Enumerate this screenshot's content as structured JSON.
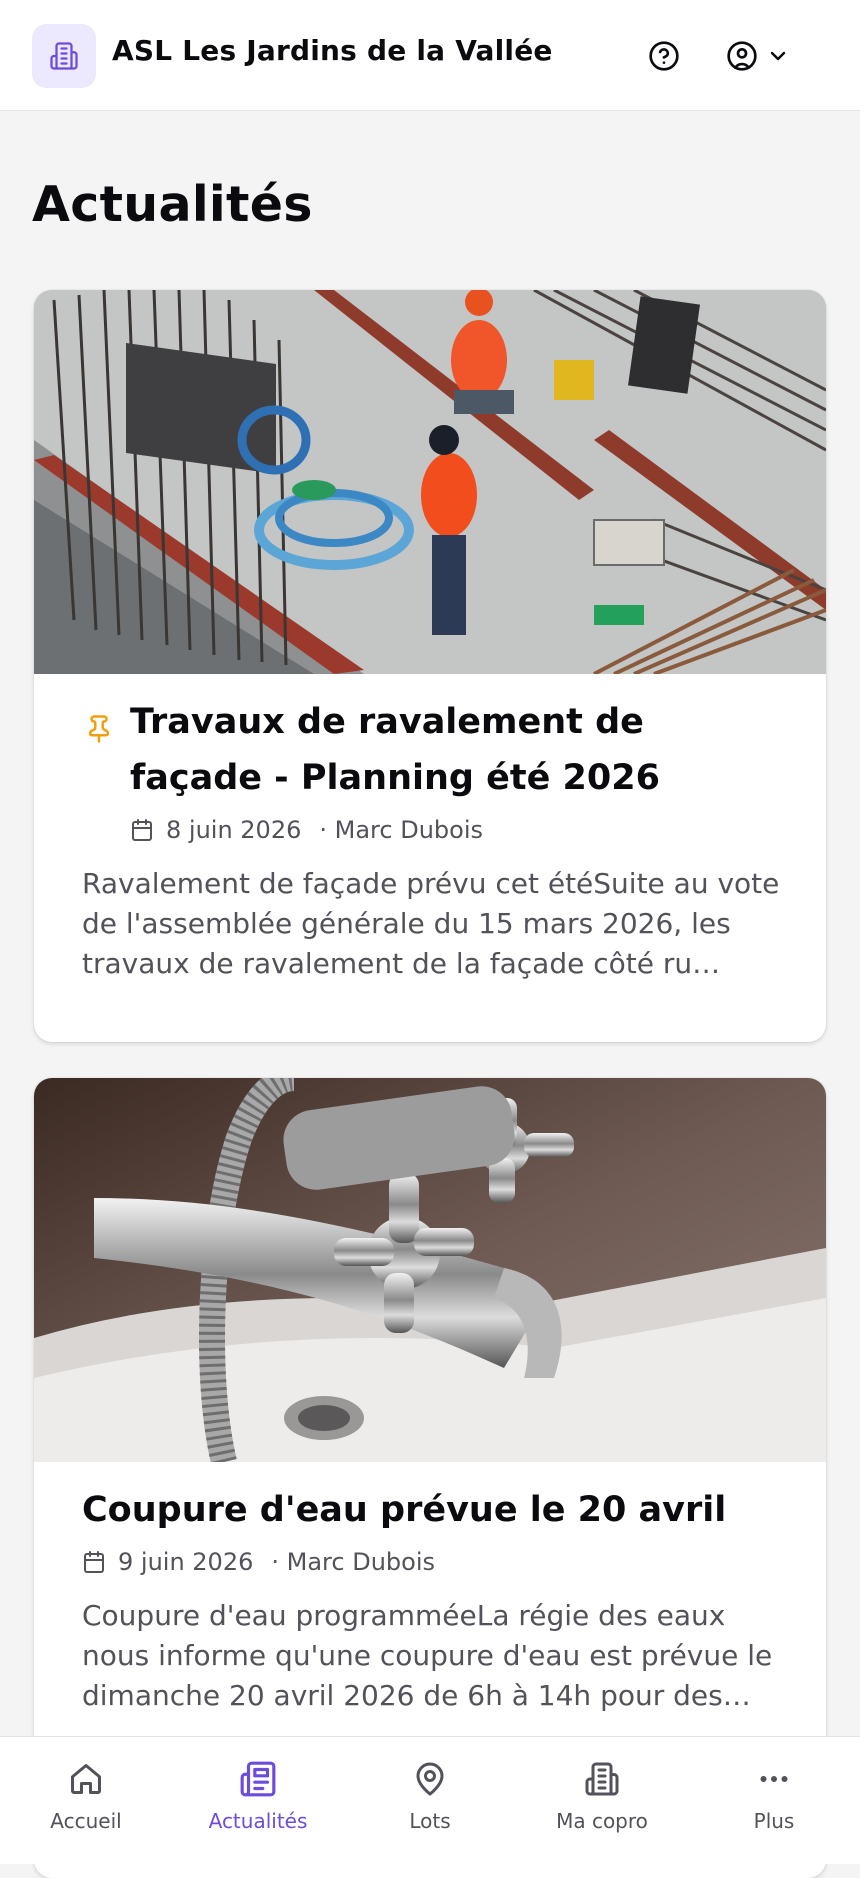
{
  "header": {
    "title": "ASL Les Jardins de la Vallée"
  },
  "page": {
    "title": "Actualités"
  },
  "news": [
    {
      "pinned": true,
      "title": "Travaux de ravalement de façade - Planning été 2026",
      "date": "8 juin 2026",
      "author": "· Marc Dubois",
      "excerpt": "Ravalement de façade prévu cet étéSuite au vote de l'assemblée générale du 15 mars 2026, les travaux de ravalement de la façade côté ru…"
    },
    {
      "pinned": false,
      "title": "Coupure d'eau prévue le 20 avril",
      "date": "9 juin 2026",
      "author": "· Marc Dubois",
      "excerpt": "Coupure d'eau programméeLa régie des eaux nous informe qu'une coupure d'eau est prévue le dimanche 20 avril 2026 de 6h à 14h pour des…"
    }
  ],
  "nav": [
    {
      "label": "Accueil",
      "icon": "home-icon",
      "active": false
    },
    {
      "label": "Actualités",
      "icon": "newspaper-icon",
      "active": true
    },
    {
      "label": "Lots",
      "icon": "map-pin-icon",
      "active": false
    },
    {
      "label": "Ma copro",
      "icon": "building-icon",
      "active": false
    },
    {
      "label": "Plus",
      "icon": "more-horizontal-icon",
      "active": false
    }
  ],
  "colors": {
    "accent": "#6d4bdc",
    "pin": "#f59e0b",
    "logo_bg": "#ece9fe"
  }
}
